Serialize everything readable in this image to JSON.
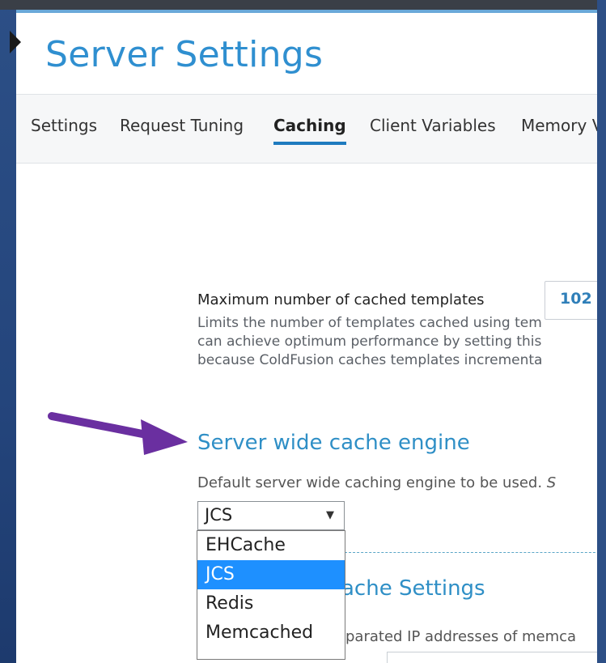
{
  "page": {
    "title": "Server Settings"
  },
  "tabs": [
    {
      "label": "Settings",
      "active": false
    },
    {
      "label": "Request Tuning",
      "active": false
    },
    {
      "label": "Caching",
      "active": true
    },
    {
      "label": "Client Variables",
      "active": false
    },
    {
      "label": "Memory V",
      "active": false
    }
  ],
  "templates": {
    "label": "Maximum number of cached templates",
    "value": "102",
    "description_lines": [
      "Limits the number of templates cached using tem",
      "can achieve optimum performance by setting this",
      "because ColdFusion caches templates incrementa"
    ]
  },
  "cache_engine": {
    "title": "Server wide cache engine",
    "help_text": "Default server wide caching engine to be used. ",
    "help_emphasis": "S",
    "selected": "JCS",
    "options": [
      "EHCache",
      "JCS",
      "Redis",
      "Memcached"
    ],
    "highlighted_option": "JCS"
  },
  "memcached": {
    "title_partial": "ache Settings",
    "help_partial": "parated IP addresses of memca"
  },
  "colors": {
    "accent": "#2f8fd0",
    "tab_underline": "#1f7bbf",
    "highlight": "#1e90ff",
    "arrow": "#6a2fa0",
    "background": "#2c4f86"
  },
  "icons": {
    "select_caret": "▼",
    "annotation_arrow": "arrow-right-icon"
  }
}
